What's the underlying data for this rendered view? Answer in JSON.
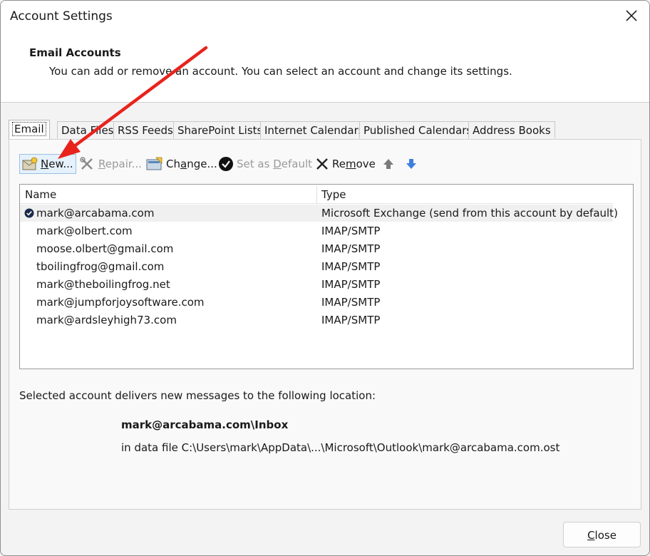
{
  "window": {
    "title": "Account Settings"
  },
  "header": {
    "title": "Email Accounts",
    "description": "You can add or remove an account. You can select an account and change its settings."
  },
  "tabs": [
    {
      "label": "Email",
      "active": true
    },
    {
      "label": "Data Files"
    },
    {
      "label": "RSS Feeds"
    },
    {
      "label": "SharePoint Lists"
    },
    {
      "label": "Internet Calendars"
    },
    {
      "label": "Published Calendars"
    },
    {
      "label": "Address Books"
    }
  ],
  "toolbar": {
    "new": {
      "pre": "",
      "key": "N",
      "post": "ew..."
    },
    "repair": {
      "pre": "",
      "key": "R",
      "post": "epair..."
    },
    "change": {
      "pre": "Ch",
      "key": "a",
      "post": "nge..."
    },
    "set_default": {
      "pre": "Set as ",
      "key": "D",
      "post": "efault"
    },
    "remove": {
      "pre": "Re",
      "key": "m",
      "post": "ove"
    }
  },
  "accounts_table": {
    "headers": {
      "name": "Name",
      "type": "Type"
    },
    "rows": [
      {
        "name": "mark@arcabama.com",
        "type": "Microsoft Exchange (send from this account by default)"
      },
      {
        "name": "mark@olbert.com",
        "type": "IMAP/SMTP"
      },
      {
        "name": "moose.olbert@gmail.com",
        "type": "IMAP/SMTP"
      },
      {
        "name": "tboilingfrog@gmail.com",
        "type": "IMAP/SMTP"
      },
      {
        "name": "mark@theboilingfrog.net",
        "type": "IMAP/SMTP"
      },
      {
        "name": "mark@jumpforjoysoftware.com",
        "type": "IMAP/SMTP"
      },
      {
        "name": "mark@ardsleyhigh73.com",
        "type": "IMAP/SMTP"
      }
    ]
  },
  "delivery": {
    "description": "Selected account delivers new messages to the following location:",
    "inbox": "mark@arcabama.com\\Inbox",
    "data_file": "in data file C:\\Users\\mark\\AppData\\...\\Microsoft\\Outlook\\mark@arcabama.com.ost"
  },
  "footer": {
    "close": {
      "key": "C",
      "post": "lose"
    }
  },
  "colors": {
    "annotation_arrow": "#e8231c",
    "hover_border": "#99c1e6",
    "hover_fill": "#e5f1fb",
    "move_down_arrow": "#3f7fe0"
  }
}
